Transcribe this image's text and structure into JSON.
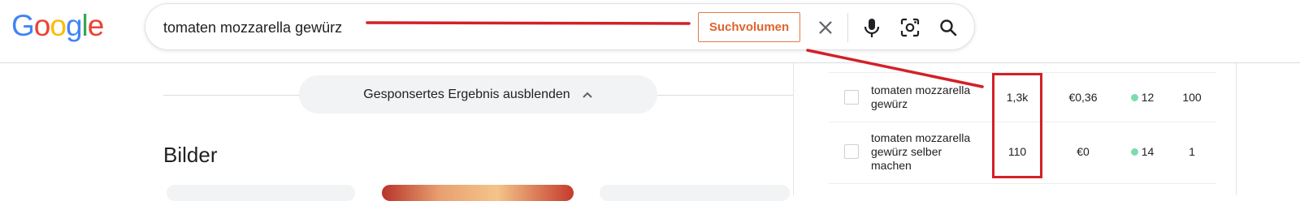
{
  "logo": {
    "letters": [
      "G",
      "o",
      "o",
      "g",
      "l",
      "e"
    ],
    "colors": [
      "#4285F4",
      "#EA4335",
      "#FBBC05",
      "#4285F4",
      "#34A853",
      "#EA4335"
    ]
  },
  "search": {
    "query": "tomaten mozzarella gewürz",
    "badge_label": "Suchvolumen",
    "clear_icon": "close-icon",
    "voice_icon": "microphone-icon",
    "lens_icon": "camera-lens-icon",
    "search_icon": "search-icon"
  },
  "main": {
    "hide_sponsored_label": "Gesponsertes Ergebnis ausblenden",
    "hide_sponsored_icon": "chevron-up-icon",
    "images_heading": "Bilder"
  },
  "keywords": {
    "rows": [
      {
        "keyword": "tomaten mozzarella gewürz",
        "volume": "1,3k",
        "cpc": "€0,36",
        "difficulty": "12",
        "score": "100",
        "difficulty_color": "#7ddbb0"
      },
      {
        "keyword": "tomaten mozzarella gewürz selber machen",
        "volume": "110",
        "cpc": "€0",
        "difficulty": "14",
        "score": "1",
        "difficulty_color": "#7ddbb0"
      }
    ]
  },
  "annotation": {
    "color": "#d32027"
  }
}
